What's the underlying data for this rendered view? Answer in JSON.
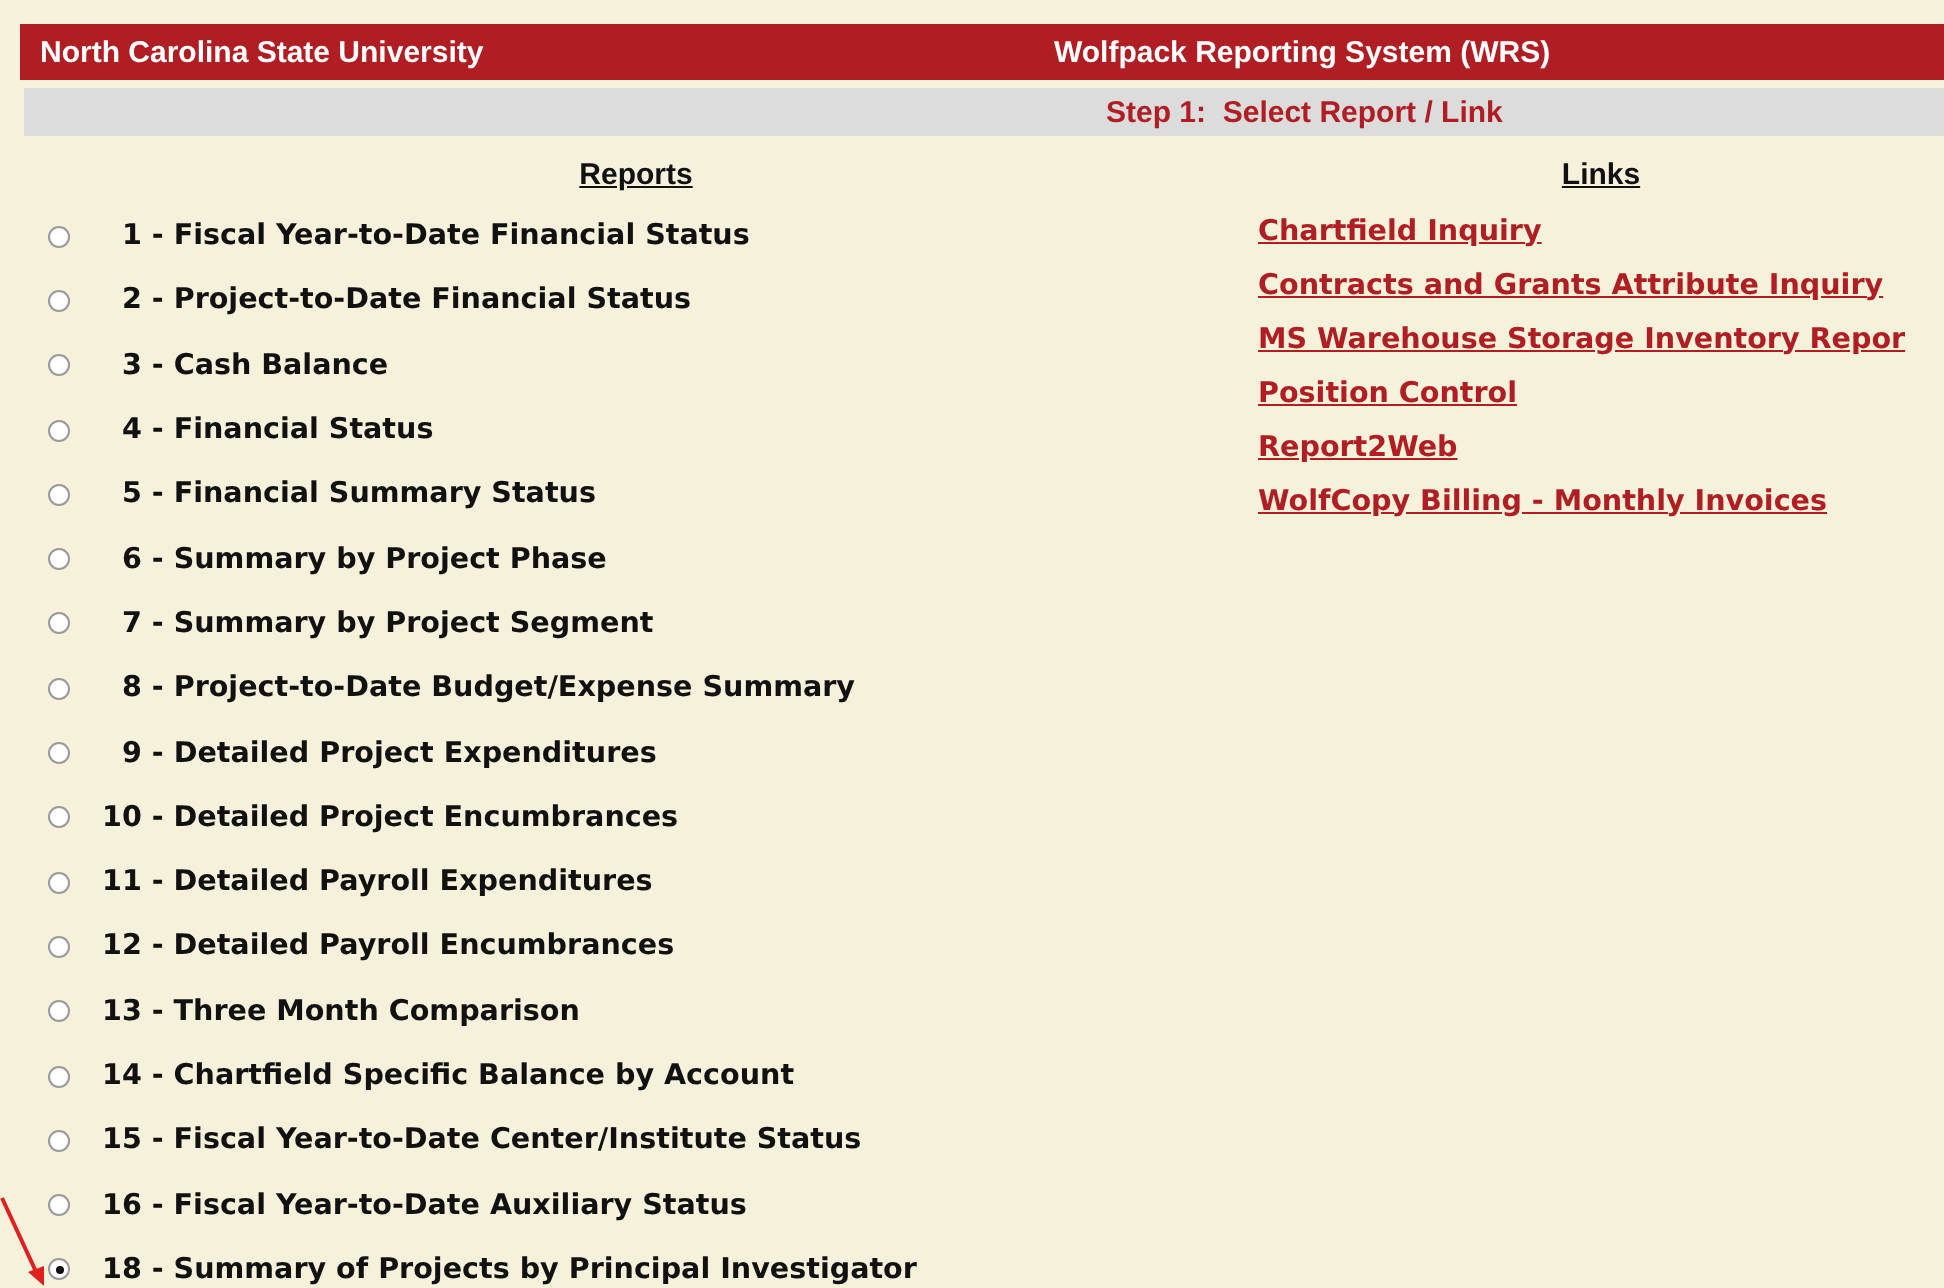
{
  "header": {
    "institution": "North Carolina State University",
    "system": "Wolfpack Reporting System (WRS)"
  },
  "step": "Step 1:  Select Report / Link",
  "reports": {
    "heading": "Reports",
    "items": [
      {
        "label": "1 - Fiscal Year-to-Date Financial Status",
        "selected": false
      },
      {
        "label": "2 - Project-to-Date Financial Status",
        "selected": false
      },
      {
        "label": "3 - Cash Balance",
        "selected": false
      },
      {
        "label": "4 - Financial Status",
        "selected": false
      },
      {
        "label": "5 - Financial Summary Status",
        "selected": false
      },
      {
        "label": "6 - Summary by Project Phase",
        "selected": false
      },
      {
        "label": "7 - Summary by Project Segment",
        "selected": false
      },
      {
        "label": "8 - Project-to-Date Budget/Expense Summary",
        "selected": false
      },
      {
        "label": "9 - Detailed Project Expenditures",
        "selected": false
      },
      {
        "label": "10 - Detailed Project Encumbrances",
        "selected": false
      },
      {
        "label": "11 - Detailed Payroll Expenditures",
        "selected": false
      },
      {
        "label": "12 - Detailed Payroll Encumbrances",
        "selected": false
      },
      {
        "label": "13 - Three Month Comparison",
        "selected": false
      },
      {
        "label": "14 - Chartfield Specific Balance by Account",
        "selected": false
      },
      {
        "label": "15 - Fiscal Year-to-Date Center/Institute Status",
        "selected": false
      },
      {
        "label": "16 - Fiscal Year-to-Date Auxiliary Status",
        "selected": false
      },
      {
        "label": "18 - Summary of Projects by Principal Investigator",
        "selected": true
      }
    ]
  },
  "links": {
    "heading": "Links",
    "items": [
      "Chartfield Inquiry",
      "Contracts and Grants Attribute Inquiry",
      "MS Warehouse Storage Inventory Repor",
      "Position Control",
      "Report2Web",
      "WolfCopy Billing - Monthly Invoices"
    ]
  }
}
